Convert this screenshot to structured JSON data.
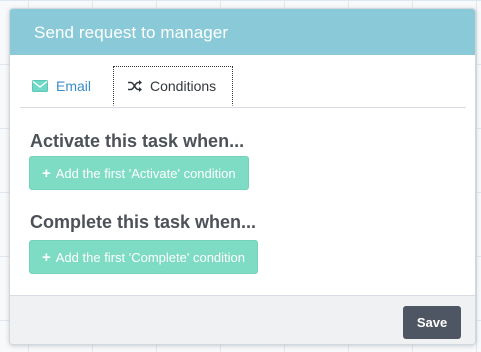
{
  "dialog": {
    "title": "Send request to manager"
  },
  "tabs": [
    {
      "label": "Email",
      "icon": "envelope-icon",
      "active": false
    },
    {
      "label": "Conditions",
      "icon": "shuffle-icon",
      "active": true
    }
  ],
  "sections": {
    "activate": {
      "heading": "Activate this task when...",
      "button_label": "Add the first 'Activate' condition"
    },
    "complete": {
      "heading": "Complete this task when...",
      "button_label": "Add the first 'Complete' condition"
    }
  },
  "footer": {
    "save_label": "Save"
  },
  "colors": {
    "header": "#89c9d8",
    "link": "#3b8ec9",
    "add_button": "#7ddcc3",
    "save_button": "#4e5663"
  }
}
